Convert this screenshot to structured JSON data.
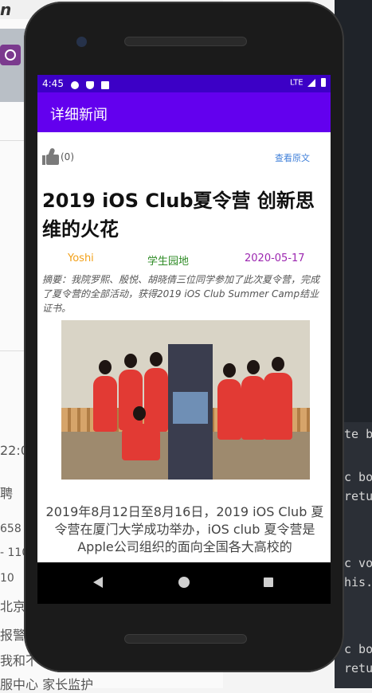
{
  "background_desktop": {
    "logo_text": "n",
    "time_fragment": "22:0",
    "tab_fragment": "聘",
    "numbers": [
      "658",
      "- 110",
      "10"
    ],
    "lines": [
      "北京",
      "报警",
      "我和不",
      "服中心 家长监护"
    ]
  },
  "background_editor": {
    "code_lines": [
      "te b",
      "c bo",
      "retu",
      "c vo",
      "his.",
      "c bo",
      "retur"
    ]
  },
  "status_bar": {
    "time": "4:45",
    "network": "LTE"
  },
  "app_bar": {
    "title": "详细新闻"
  },
  "article": {
    "like_count": "(0)",
    "view_original": "查看原文",
    "title": "2019 iOS Club夏令营 创新思维的火花",
    "author": "Yoshi",
    "category": "学生园地",
    "date": "2020-05-17",
    "summary": "摘要：我院罗熙、殷悦、胡晓倩三位同学参加了此次夏令营，完成了夏令营的全部活动，获得2019 iOS Club Summer Camp结业证书。",
    "body": "2019年8月12日至8月16日，2019 iOS Club 夏令营在厦门大学成功举办，iOS club 夏令营是Apple公司组织的面向全国各大高校的"
  },
  "colors": {
    "status_bar": "#3c00c6",
    "app_bar": "#6300ee",
    "author": "#f2a018",
    "category": "#2e8b25",
    "date": "#9c27b0",
    "link": "#3f7fd9"
  }
}
